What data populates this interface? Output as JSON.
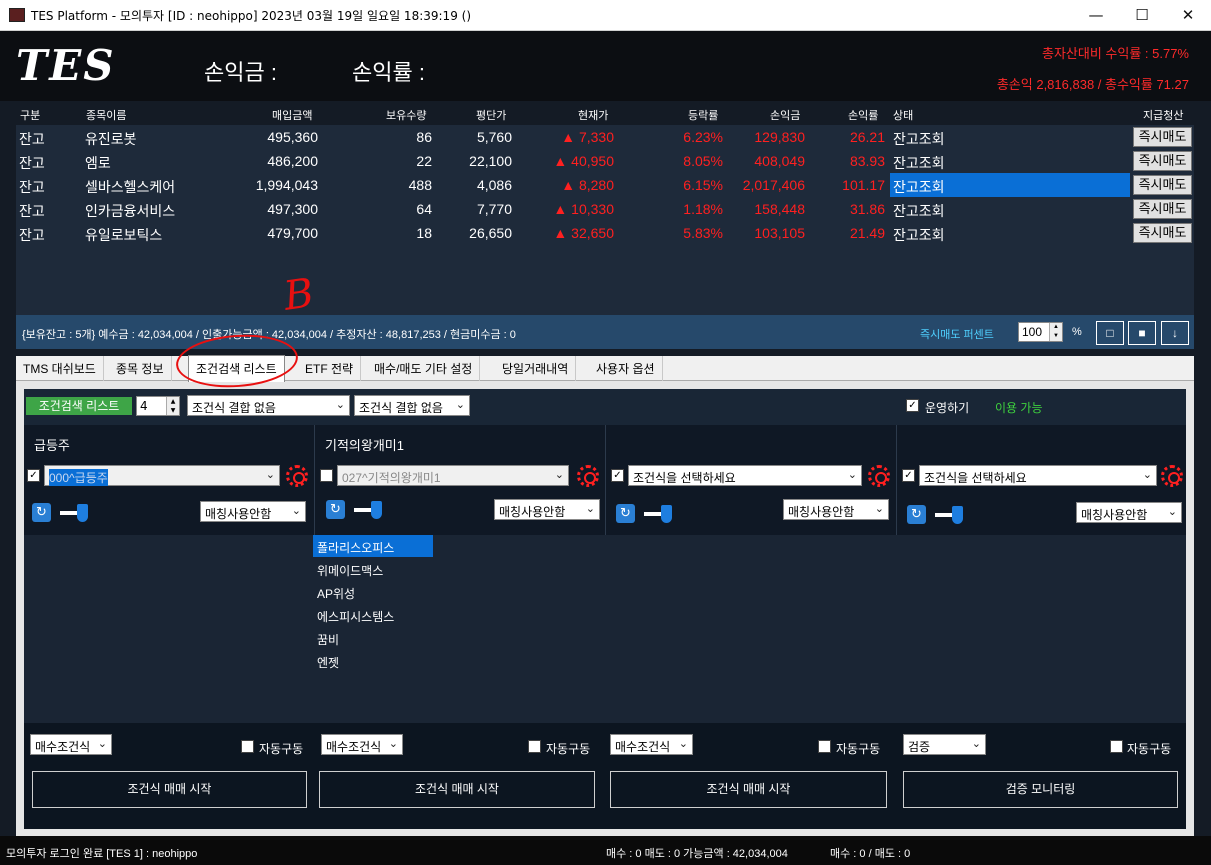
{
  "window": {
    "title": "TES Platform - 모의투자 [ID : neohippo] 2023년 03월 19일 일요일 18:39:19 ()",
    "min_label": "—",
    "max_label": "☐",
    "close_label": "✕"
  },
  "header": {
    "logo": "TES",
    "pnl_label": "손익금 :",
    "rate_label": "손익률 :",
    "total_asset_return": "총자산대비 수익률 : 5.77%",
    "total_pnl": "총손익 2,816,838 / 총수익률 71.27"
  },
  "grid": {
    "columns": [
      "구분",
      "종목이름",
      "매입금액",
      "보유수량",
      "평단가",
      "현재가",
      "등락률",
      "손익금",
      "손익률",
      "상태",
      "지급청산"
    ],
    "rows": [
      {
        "type": "잔고",
        "name": "유진로봇",
        "buy": "495,360",
        "qty": "86",
        "avg": "5,760",
        "price": "▲ 7,330",
        "chg": "6.23%",
        "pnl": "129,830",
        "rate": "26.21",
        "status": "잔고조회",
        "action": "즉시매도"
      },
      {
        "type": "잔고",
        "name": "엠로",
        "buy": "486,200",
        "qty": "22",
        "avg": "22,100",
        "price": "▲ 40,950",
        "chg": "8.05%",
        "pnl": "408,049",
        "rate": "83.93",
        "status": "잔고조회",
        "action": "즉시매도"
      },
      {
        "type": "잔고",
        "name": "셀바스헬스케어",
        "buy": "1,994,043",
        "qty": "488",
        "avg": "4,086",
        "price": "▲ 8,280",
        "chg": "6.15%",
        "pnl": "2,017,406",
        "rate": "101.17",
        "status": "잔고조회",
        "action": "즉시매도"
      },
      {
        "type": "잔고",
        "name": "인카금융서비스",
        "buy": "497,300",
        "qty": "64",
        "avg": "7,770",
        "price": "▲ 10,330",
        "chg": "1.18%",
        "pnl": "158,448",
        "rate": "31.86",
        "status": "잔고조회",
        "action": "즉시매도"
      },
      {
        "type": "잔고",
        "name": "유일로보틱스",
        "buy": "479,700",
        "qty": "18",
        "avg": "26,650",
        "price": "▲ 32,650",
        "chg": "5.83%",
        "pnl": "103,105",
        "rate": "21.49",
        "status": "잔고조회",
        "action": "즉시매도"
      }
    ]
  },
  "info_bar": {
    "summary": "{보유잔고 : 5개}     예수금 : 42,034,004 / 인출가능금액 : 42,034,004 / 추정자산 : 48,817,253 / 현금미수금 : 0",
    "sell_percent_label": "즉시매도 퍼센트",
    "sell_percent_value": "100",
    "percent_sign": "%",
    "btn1": "□",
    "btn2": "■",
    "btn3": "↓"
  },
  "tabs": [
    "TMS 대쉬보드",
    "종목 정보",
    "조건검색 리스트",
    "ETF 전략",
    "매수/매도 기타 설정",
    "당일거래내역",
    "사용자 옵션"
  ],
  "cond": {
    "list_button": "조건검색 리스트",
    "count": "4",
    "combine1": "조건식 결합 없음",
    "combine2": "조건식 결합 없음",
    "operate_label": "운영하기",
    "available": "이용 가능",
    "columns": [
      {
        "title": "급등주",
        "select": "000^급등주",
        "match": "매칭사용안함",
        "buy_cond": "매수조건식",
        "auto": "자동구동",
        "start": "조건식 매매 시작"
      },
      {
        "title": "기적의왕개미1",
        "select": "027^기적의왕개미1",
        "match": "매칭사용안함",
        "buy_cond": "매수조건식",
        "auto": "자동구동",
        "start": "조건식 매매 시작"
      },
      {
        "title": "",
        "select": "조건식을 선택하세요",
        "match": "매칭사용안함",
        "buy_cond": "매수조건식",
        "auto": "자동구동",
        "start": "조건식 매매 시작"
      },
      {
        "title": "",
        "select": "조건식을 선택하세요",
        "match": "매칭사용안함",
        "buy_cond": "검증",
        "auto": "자동구동",
        "start": "검증 모니터링"
      }
    ],
    "stock_list": [
      "폴라리스오피스",
      "위메이드맥스",
      "AP위성",
      "에스피시스템스",
      "꿈비",
      "엔젯"
    ]
  },
  "statusbar": {
    "left": "모의투자 로그인 완료 [TES 1] : neohippo",
    "mid": "매수 : 0 매도 : 0 가능금액 : 42,034,004",
    "right": "매수 : 0 / 매도 : 0"
  },
  "annotation": {
    "letter": "B"
  },
  "colors": {
    "positive": "#ff2020",
    "selection": "#0a6fd6",
    "accent_green": "#3ea547",
    "info_bar": "#26496b"
  }
}
